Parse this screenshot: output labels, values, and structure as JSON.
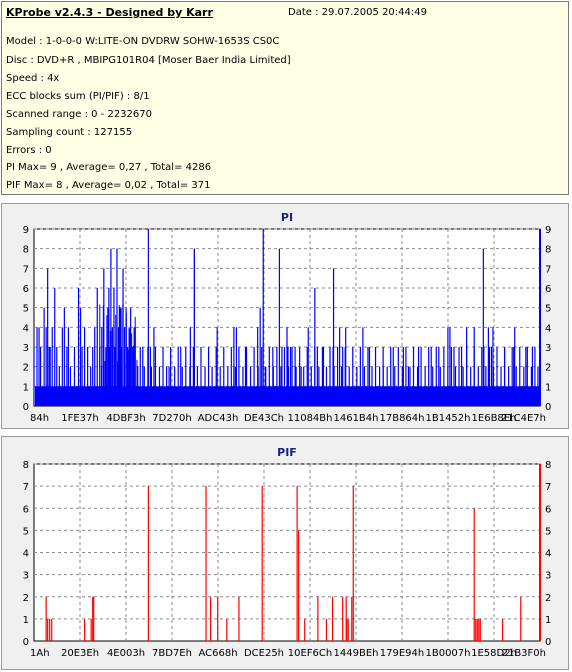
{
  "info": {
    "title": "KProbe v2.4.3 - Designed by Karr",
    "date": "Date : 29.07.2005 20:44:49",
    "lines": [
      "Model : 1-0-0-0 W:LITE-ON DVDRW SOHW-1653S CS0C",
      "Disc : DVD+R , MBIPG101R04 [Moser Baer India Limited]",
      "Speed : 4x",
      "ECC blocks sum (PI/PIF) : 8/1",
      "Scanned range : 0 - 2232670",
      "Sampling count : 127155",
      "Errors : 0",
      "PI Max= 9 , Average= 0,27 , Total= 4286",
      "PIF Max= 8 , Average= 0,02 , Total= 371"
    ]
  },
  "colors": {
    "pi": "#0000ff",
    "pif": "#ff0000",
    "grid": "#8c8c8c",
    "plot_bg": "#ffffff"
  },
  "chart_data": [
    {
      "type": "bar",
      "title": "PI",
      "ylim": [
        0,
        9
      ],
      "yticks": [
        "0",
        "1",
        "2",
        "3",
        "4",
        "5",
        "6",
        "7",
        "8",
        "9"
      ],
      "xticks": [
        "84h",
        "1FE37h",
        "4DBF3h",
        "7D270h",
        "ADC43h",
        "DE43Ch",
        "11084Bh",
        "1461B4h",
        "17B864h",
        "1B1452h",
        "1E6B8Eh",
        "21C4E7h"
      ],
      "grid": true,
      "series": [
        {
          "baseline": 1,
          "spikes": [
            [
              0.0,
              3
            ],
            [
              0.006,
              4
            ],
            [
              0.01,
              4
            ],
            [
              0.013,
              3
            ],
            [
              0.02,
              5
            ],
            [
              0.024,
              4
            ],
            [
              0.027,
              7
            ],
            [
              0.032,
              3
            ],
            [
              0.036,
              4
            ],
            [
              0.041,
              6
            ],
            [
              0.045,
              3
            ],
            [
              0.05,
              2
            ],
            [
              0.056,
              4
            ],
            [
              0.06,
              5
            ],
            [
              0.065,
              3
            ],
            [
              0.072,
              2
            ],
            [
              0.08,
              3
            ],
            [
              0.088,
              6
            ],
            [
              0.095,
              3
            ],
            [
              0.1,
              4
            ],
            [
              0.106,
              3
            ],
            [
              0.112,
              2
            ],
            [
              0.12,
              4
            ],
            [
              0.125,
              6
            ],
            [
              0.13,
              3
            ],
            [
              0.134,
              4
            ],
            [
              0.138,
              7
            ],
            [
              0.142,
              3
            ],
            [
              0.146,
              5
            ],
            [
              0.15,
              3
            ],
            [
              0.152,
              8
            ],
            [
              0.155,
              4
            ],
            [
              0.158,
              6
            ],
            [
              0.16,
              3
            ],
            [
              0.164,
              8
            ],
            [
              0.167,
              4
            ],
            [
              0.17,
              5
            ],
            [
              0.173,
              3
            ],
            [
              0.176,
              7
            ],
            [
              0.179,
              4
            ],
            [
              0.182,
              5
            ],
            [
              0.185,
              3
            ],
            [
              0.188,
              4
            ],
            [
              0.191,
              5
            ],
            [
              0.195,
              3
            ],
            [
              0.2,
              4
            ],
            [
              0.205,
              2
            ],
            [
              0.21,
              3
            ],
            [
              0.218,
              2
            ],
            [
              0.225,
              3
            ],
            [
              0.232,
              2
            ],
            [
              0.24,
              3
            ],
            [
              0.248,
              2
            ],
            [
              0.255,
              3
            ],
            [
              0.262,
              2
            ],
            [
              0.27,
              3
            ],
            [
              0.278,
              2
            ],
            [
              0.285,
              3
            ],
            [
              0.293,
              2
            ],
            [
              0.3,
              3
            ],
            [
              0.308,
              2
            ],
            [
              0.315,
              3
            ],
            [
              0.323,
              2
            ],
            [
              0.33,
              3
            ],
            [
              0.338,
              2
            ],
            [
              0.345,
              3
            ],
            [
              0.352,
              2
            ],
            [
              0.36,
              3
            ],
            [
              0.368,
              2
            ],
            [
              0.375,
              3
            ],
            [
              0.383,
              2
            ],
            [
              0.39,
              3
            ],
            [
              0.398,
              2
            ],
            [
              0.405,
              3
            ],
            [
              0.413,
              2
            ],
            [
              0.42,
              3
            ],
            [
              0.428,
              2
            ],
            [
              0.435,
              3
            ],
            [
              0.443,
              2
            ],
            [
              0.45,
              3
            ],
            [
              0.458,
              2
            ],
            [
              0.465,
              3
            ],
            [
              0.473,
              2
            ],
            [
              0.48,
              3
            ],
            [
              0.488,
              2
            ],
            [
              0.495,
              3
            ],
            [
              0.503,
              2
            ],
            [
              0.51,
              3
            ],
            [
              0.518,
              2
            ],
            [
              0.525,
              3
            ],
            [
              0.533,
              2
            ],
            [
              0.54,
              3
            ],
            [
              0.548,
              2
            ],
            [
              0.555,
              3
            ],
            [
              0.563,
              2
            ],
            [
              0.57,
              3
            ],
            [
              0.578,
              2
            ],
            [
              0.585,
              3
            ],
            [
              0.593,
              2
            ],
            [
              0.6,
              3
            ],
            [
              0.608,
              2
            ],
            [
              0.615,
              3
            ],
            [
              0.623,
              2
            ],
            [
              0.63,
              3
            ],
            [
              0.638,
              2
            ],
            [
              0.645,
              3
            ],
            [
              0.653,
              2
            ],
            [
              0.66,
              3
            ],
            [
              0.668,
              2
            ],
            [
              0.675,
              3
            ],
            [
              0.683,
              2
            ],
            [
              0.69,
              3
            ],
            [
              0.698,
              2
            ],
            [
              0.705,
              3
            ],
            [
              0.713,
              2
            ],
            [
              0.72,
              3
            ],
            [
              0.728,
              2
            ],
            [
              0.735,
              3
            ],
            [
              0.743,
              2
            ],
            [
              0.75,
              3
            ],
            [
              0.758,
              2
            ],
            [
              0.765,
              3
            ],
            [
              0.773,
              2
            ],
            [
              0.78,
              3
            ],
            [
              0.788,
              2
            ],
            [
              0.795,
              3
            ],
            [
              0.803,
              2
            ],
            [
              0.81,
              3
            ],
            [
              0.818,
              2
            ],
            [
              0.825,
              3
            ],
            [
              0.833,
              2
            ],
            [
              0.84,
              3
            ],
            [
              0.848,
              2
            ],
            [
              0.855,
              3
            ],
            [
              0.863,
              2
            ],
            [
              0.87,
              3
            ],
            [
              0.878,
              2
            ],
            [
              0.885,
              3
            ],
            [
              0.893,
              2
            ],
            [
              0.9,
              3
            ],
            [
              0.908,
              2
            ],
            [
              0.915,
              3
            ],
            [
              0.923,
              2
            ],
            [
              0.93,
              3
            ],
            [
              0.938,
              2
            ],
            [
              0.945,
              3
            ],
            [
              0.953,
              2
            ],
            [
              0.96,
              3
            ],
            [
              0.968,
              2
            ],
            [
              0.975,
              3
            ],
            [
              0.983,
              2
            ],
            [
              0.99,
              3
            ],
            [
              0.996,
              2
            ],
            [
              0.03,
              3
            ],
            [
              0.068,
              4
            ],
            [
              0.092,
              5
            ],
            [
              0.116,
              3
            ],
            [
              0.148,
              6
            ],
            [
              0.172,
              5
            ],
            [
              0.198,
              4
            ],
            [
              0.215,
              3
            ],
            [
              0.23,
              3
            ],
            [
              0.237,
              4
            ],
            [
              0.267,
              2
            ],
            [
              0.29,
              3
            ],
            [
              0.317,
              8
            ],
            [
              0.362,
              4
            ],
            [
              0.395,
              4
            ],
            [
              0.4,
              4
            ],
            [
              0.418,
              3
            ],
            [
              0.442,
              4
            ],
            [
              0.447,
              5
            ],
            [
              0.457,
              2
            ],
            [
              0.472,
              3
            ],
            [
              0.49,
              3
            ],
            [
              0.502,
              3
            ],
            [
              0.507,
              3
            ],
            [
              0.516,
              3
            ],
            [
              0.528,
              2
            ],
            [
              0.542,
              4
            ],
            [
              0.56,
              3
            ],
            [
              0.572,
              3
            ],
            [
              0.591,
              3
            ],
            [
              0.61,
              3
            ],
            [
              0.616,
              4
            ],
            [
              0.65,
              4
            ],
            [
              0.663,
              3
            ],
            [
              0.69,
              2
            ],
            [
              0.71,
              3
            ],
            [
              0.73,
              3
            ],
            [
              0.74,
              2
            ],
            [
              0.76,
              3
            ],
            [
              0.785,
              3
            ],
            [
              0.8,
              3
            ],
            [
              0.822,
              4
            ],
            [
              0.83,
              3
            ],
            [
              0.845,
              3
            ],
            [
              0.87,
              4
            ],
            [
              0.889,
              3
            ],
            [
              0.898,
              4
            ],
            [
              0.904,
              3
            ],
            [
              0.93,
              3
            ],
            [
              0.95,
              4
            ],
            [
              0.972,
              3
            ],
            [
              0.985,
              3
            ],
            [
              0.226,
              9
            ],
            [
              0.309,
              4
            ],
            [
              0.317,
              8
            ],
            [
              0.453,
              9
            ],
            [
              0.485,
              8
            ],
            [
              0.5,
              4
            ],
            [
              0.555,
              6
            ],
            [
              0.592,
              7
            ],
            [
              0.604,
              4
            ],
            [
              0.818,
              4
            ],
            [
              0.855,
              4
            ],
            [
              0.888,
              8
            ],
            [
              0.907,
              4
            ],
            [
              0.948,
              3
            ]
          ],
          "dense_region": [
            0.13,
            0.205
          ]
        }
      ]
    },
    {
      "type": "bar",
      "title": "PIF",
      "ylim": [
        0,
        8
      ],
      "yticks": [
        "0",
        "1",
        "2",
        "3",
        "4",
        "5",
        "6",
        "7",
        "8"
      ],
      "xticks": [
        "1Ah",
        "20E3Eh",
        "4E003h",
        "7BD7Eh",
        "AC668h",
        "DCE25h",
        "10EF6Ch",
        "1449BEh",
        "179E94h",
        "1B0007h",
        "1E58D2h",
        "21B3F0h"
      ],
      "grid": true,
      "series": [
        {
          "spikes": [
            [
              0.024,
              2
            ],
            [
              0.027,
              1
            ],
            [
              0.031,
              1
            ],
            [
              0.035,
              1
            ],
            [
              0.1,
              1
            ],
            [
              0.113,
              1
            ],
            [
              0.116,
              2
            ],
            [
              0.118,
              2
            ],
            [
              0.226,
              7
            ],
            [
              0.34,
              7
            ],
            [
              0.349,
              2
            ],
            [
              0.363,
              2
            ],
            [
              0.381,
              1
            ],
            [
              0.405,
              2
            ],
            [
              0.451,
              7
            ],
            [
              0.52,
              7
            ],
            [
              0.523,
              5
            ],
            [
              0.535,
              1
            ],
            [
              0.561,
              2
            ],
            [
              0.578,
              1
            ],
            [
              0.59,
              2
            ],
            [
              0.61,
              2
            ],
            [
              0.617,
              2
            ],
            [
              0.618,
              1
            ],
            [
              0.621,
              1
            ],
            [
              0.628,
              2
            ],
            [
              0.631,
              7
            ],
            [
              0.87,
              6
            ],
            [
              0.873,
              1
            ],
            [
              0.876,
              1
            ],
            [
              0.879,
              1
            ],
            [
              0.882,
              1
            ],
            [
              0.926,
              1
            ],
            [
              0.962,
              2
            ]
          ]
        }
      ]
    }
  ]
}
